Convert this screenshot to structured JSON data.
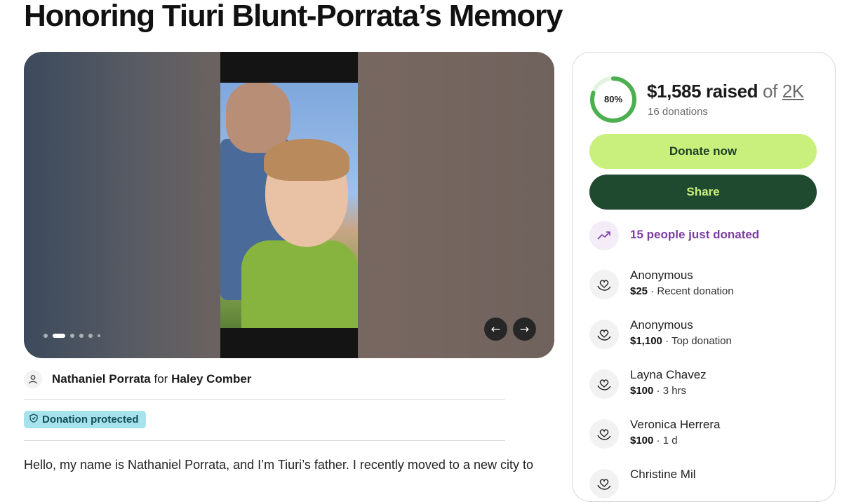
{
  "page": {
    "title": "Honoring Tiuri Blunt-Porrata’s Memory"
  },
  "gallery": {
    "slide_count": 6,
    "active_slide": 2,
    "prev_symbol": "←",
    "next_symbol": "→"
  },
  "organizer": {
    "name": "Nathaniel Porrata",
    "for_text": "for",
    "beneficiary": "Haley Comber"
  },
  "badge": {
    "label": "Donation protected"
  },
  "story": {
    "first_line": "Hello, my name is Nathaniel Porrata, and I’m Tiuri’s father. I recently moved to a new city to"
  },
  "progress": {
    "percent": 80,
    "percent_label": "80%",
    "raised": "$1,585 raised",
    "of_text": "of",
    "goal": "2K",
    "count": "16 donations"
  },
  "actions": {
    "donate_label": "Donate now",
    "share_label": "Share"
  },
  "activity": {
    "recent_text": "15 people just donated"
  },
  "donations": [
    {
      "name": "Anonymous",
      "amount": "$25",
      "note": " · Recent donation"
    },
    {
      "name": "Anonymous",
      "amount": "$1,100",
      "note": " · Top donation"
    },
    {
      "name": "Layna Chavez",
      "amount": "$100",
      "note": " · 3 hrs"
    },
    {
      "name": "Veronica Herrera",
      "amount": "$100",
      "note": " · 1 d"
    },
    {
      "name": "Christine Mil",
      "amount": "",
      "note": ""
    }
  ],
  "colors": {
    "accent_green": "#c9f07c",
    "dark_green": "#1f4a30",
    "progress_green": "#4caf50",
    "purple": "#7b3ea3",
    "protected_bg": "#a7e3ec"
  }
}
